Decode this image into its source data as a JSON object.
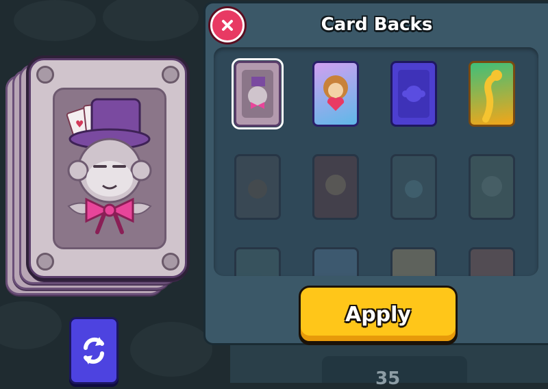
{
  "panel": {
    "title": "Card Backs",
    "apply_label": "Apply",
    "close_icon": "close-x-icon"
  },
  "preview": {
    "selected_card": "magician-monkey-card",
    "swap_icon": "swap-arrows-icon"
  },
  "card_backs": [
    {
      "name": "card-back-magician-monkey",
      "state": "selected",
      "color": "#b39aae"
    },
    {
      "name": "card-back-heart-monkey",
      "state": "unlocked",
      "color": "#5fb8e8"
    },
    {
      "name": "card-back-purple-monkey",
      "state": "unlocked",
      "color": "#4d3fd0"
    },
    {
      "name": "card-back-golden-snake",
      "state": "unlocked",
      "color": "#f3a619"
    },
    {
      "name": "card-back-chocolate-monkey",
      "state": "locked",
      "color": "#4a4a52"
    },
    {
      "name": "card-back-red-monkey",
      "state": "locked",
      "color": "#8a2a30"
    },
    {
      "name": "card-back-teal-monkey",
      "state": "locked",
      "color": "#2d5a6a"
    },
    {
      "name": "card-back-forest-owl",
      "state": "locked",
      "color": "#3a6a58"
    },
    {
      "name": "card-back-pirate",
      "state": "locked",
      "color": "#2e6a70"
    },
    {
      "name": "card-back-blue-monkey",
      "state": "locked",
      "color": "#3b7ab8"
    },
    {
      "name": "card-back-orange",
      "state": "locked",
      "color": "#c48a3a"
    },
    {
      "name": "card-back-party",
      "state": "locked",
      "color": "#b84a3a"
    }
  ],
  "footer": {
    "counter": "35"
  },
  "colors": {
    "panel": "#3b5868",
    "grid": "#2f4858",
    "apply": "#ffc619",
    "close": "#e83a63",
    "swap": "#4d43e0",
    "background": "#1f2b30"
  }
}
